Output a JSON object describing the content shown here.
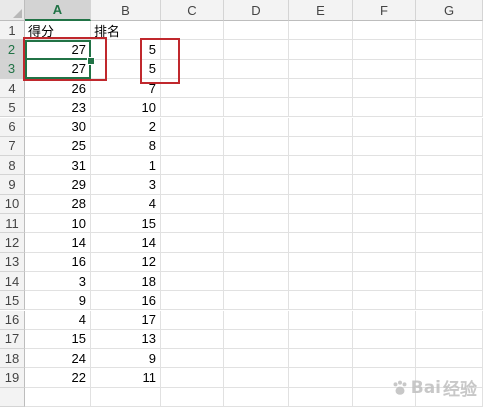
{
  "columns": [
    "A",
    "B",
    "C",
    "D",
    "E",
    "F",
    "G"
  ],
  "selected_column": "A",
  "rows": [
    {
      "row": "1",
      "a": "得分",
      "b": "排名"
    },
    {
      "row": "2",
      "a": "27",
      "b": "5"
    },
    {
      "row": "3",
      "a": "27",
      "b": "5"
    },
    {
      "row": "4",
      "a": "26",
      "b": "7"
    },
    {
      "row": "5",
      "a": "23",
      "b": "10"
    },
    {
      "row": "6",
      "a": "30",
      "b": "2"
    },
    {
      "row": "7",
      "a": "25",
      "b": "8"
    },
    {
      "row": "8",
      "a": "31",
      "b": "1"
    },
    {
      "row": "9",
      "a": "29",
      "b": "3"
    },
    {
      "row": "10",
      "a": "28",
      "b": "4"
    },
    {
      "row": "11",
      "a": "10",
      "b": "15"
    },
    {
      "row": "12",
      "a": "14",
      "b": "14"
    },
    {
      "row": "13",
      "a": "16",
      "b": "12"
    },
    {
      "row": "14",
      "a": "3",
      "b": "18"
    },
    {
      "row": "15",
      "a": "9",
      "b": "16"
    },
    {
      "row": "16",
      "a": "4",
      "b": "17"
    },
    {
      "row": "17",
      "a": "15",
      "b": "13"
    },
    {
      "row": "18",
      "a": "24",
      "b": "9"
    },
    {
      "row": "19",
      "a": "22",
      "b": "11"
    }
  ],
  "selected_rows": [
    "2",
    "3"
  ],
  "watermark": {
    "text": "Bai",
    "icon": "baidu-paw-icon",
    "suffix": "经验"
  },
  "colors": {
    "accent": "#217346",
    "highlight_box": "#c0282d"
  }
}
